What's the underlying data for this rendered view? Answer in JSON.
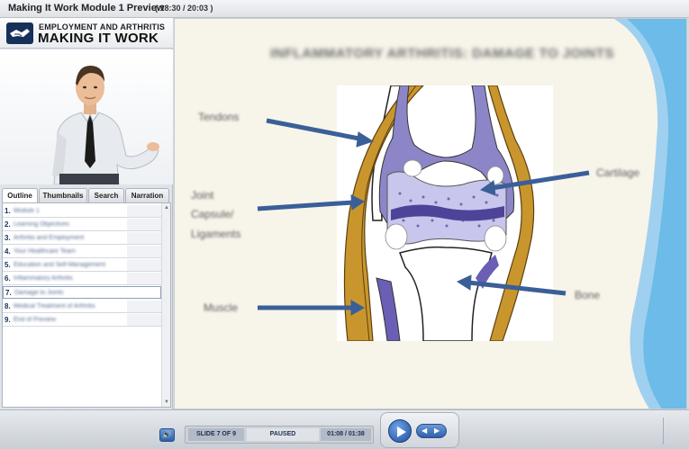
{
  "window": {
    "title": "Making It Work Module 1 Preview",
    "time": "( 18:30 / 20:03 )"
  },
  "brand": {
    "line1": "EMPLOYMENT AND ARTHRITIS",
    "line2": "MAKING IT WORK"
  },
  "tabs": [
    "Outline",
    "Thumbnails",
    "Search",
    "Narration"
  ],
  "outline": {
    "items": [
      {
        "num": "1.",
        "label": "Module 1"
      },
      {
        "num": "2.",
        "label": "Learning Objectives"
      },
      {
        "num": "3.",
        "label": "Arthritis and Employment"
      },
      {
        "num": "4.",
        "label": "Your Healthcare Team"
      },
      {
        "num": "5.",
        "label": "Education and Self-Management"
      },
      {
        "num": "6.",
        "label": "Inflammatory Arthritis"
      },
      {
        "num": "7.",
        "label": "Damage to Joints"
      },
      {
        "num": "8.",
        "label": "Medical Treatment of Arthritis"
      },
      {
        "num": "9.",
        "label": "End of Preview"
      }
    ],
    "active_index": 6
  },
  "slide": {
    "title": "INFLAMMATORY ARTHRITIS: DAMAGE TO JOINTS",
    "labels": {
      "tendons": "Tendons",
      "capsule_1": "Joint",
      "capsule_2": "Capsule/",
      "capsule_3": "Ligaments",
      "muscle": "Muscle",
      "cartilage": "Cartilage",
      "bone": "Bone"
    }
  },
  "player": {
    "slide_num": "SLIDE 7 OF 9",
    "state": "PAUSED",
    "elapsed": "01:08 / 01:38"
  },
  "colors": {
    "accent": "#2f5fa8",
    "arrow": "#3a5f98",
    "slide_bg": "#f7f4ea"
  }
}
